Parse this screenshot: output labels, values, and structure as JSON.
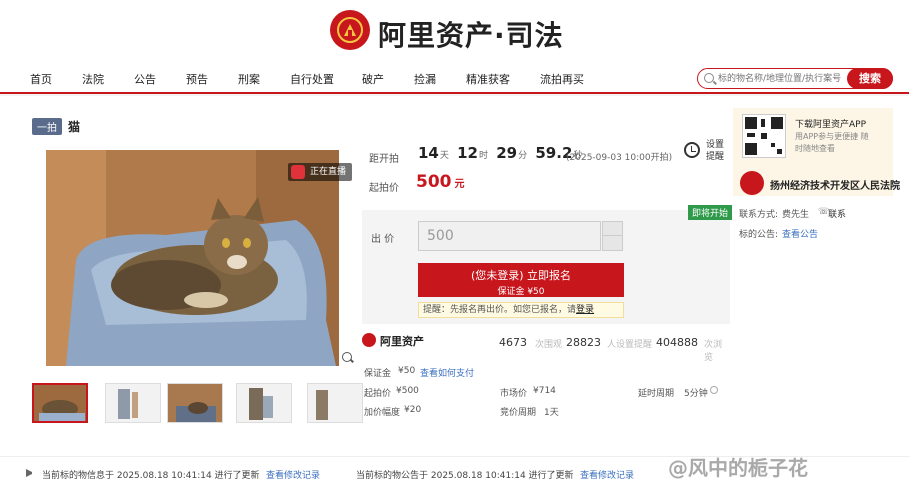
{
  "header": {
    "site_title": "阿里资产·司法"
  },
  "nav": [
    "首页",
    "法院",
    "公告",
    "预告",
    "刑案",
    "自行处置",
    "破产",
    "捡漏",
    "精准获客",
    "流拍再买"
  ],
  "search": {
    "placeholder": "标的物名称/地理位置/执行案号",
    "button": "搜索"
  },
  "item": {
    "tag": "一拍",
    "title": "猫"
  },
  "live": "正在直播",
  "auction": {
    "countdown_label": "距开拍",
    "days": "14",
    "days_unit": "天",
    "hours": "12",
    "hours_unit": "时",
    "minutes": "29",
    "minutes_unit": "分",
    "seconds": "59.2",
    "seconds_unit": "秒",
    "start_time": "(2025-09-03 10:00开拍)",
    "price_label": "起拍价",
    "price": "500",
    "price_unit": "元",
    "reminder": "设置提醒",
    "status": "即将开始",
    "bid_label": "出 价",
    "bid_value": "500",
    "register_line1": "(您未登录) 立即报名",
    "register_line2": "保证金 ¥50",
    "hint_text": "提醒：先报名再出价。如您已报名，请",
    "hint_link": "登录"
  },
  "stats": {
    "brand": "阿里资产",
    "v1": "4673",
    "l1": "次围观",
    "v2": "28823",
    "l2": "人设置提醒",
    "v3": "404888",
    "l3": "次浏览"
  },
  "details": {
    "deposit_label": "保证金",
    "deposit": "¥50",
    "deposit_link": "查看如何支付",
    "start_label": "起拍价",
    "start": "¥500",
    "market_label": "市场价",
    "market": "¥714",
    "delay_label": "延时周期",
    "delay": "5分钟",
    "step_label": "加价幅度",
    "step": "¥20",
    "period_label": "竞价周期",
    "period": "1天"
  },
  "side": {
    "app_title": "下载阿里资产APP",
    "app_desc": "用APP参与更便捷 随时随地查看",
    "court": "扬州经济技术开发区人民法院",
    "contact_label": "联系方式:",
    "contact_name": "费先生",
    "contact_link": "联系",
    "notice_label": "标的公告:",
    "notice_link": "查看公告"
  },
  "footer": {
    "left_text": "当前标的物信息于 2025.08.18 10:41:14 进行了更新",
    "left_link": "查看修改记录",
    "right_text": "当前标的物公告于 2025.08.18 10:41:14 进行了更新",
    "right_link": "查看修改记录"
  },
  "watermark": "@风中的栀子花",
  "colors": {
    "brand": "#c8161d",
    "link": "#3a6fbf",
    "status": "#2e9a4a"
  }
}
